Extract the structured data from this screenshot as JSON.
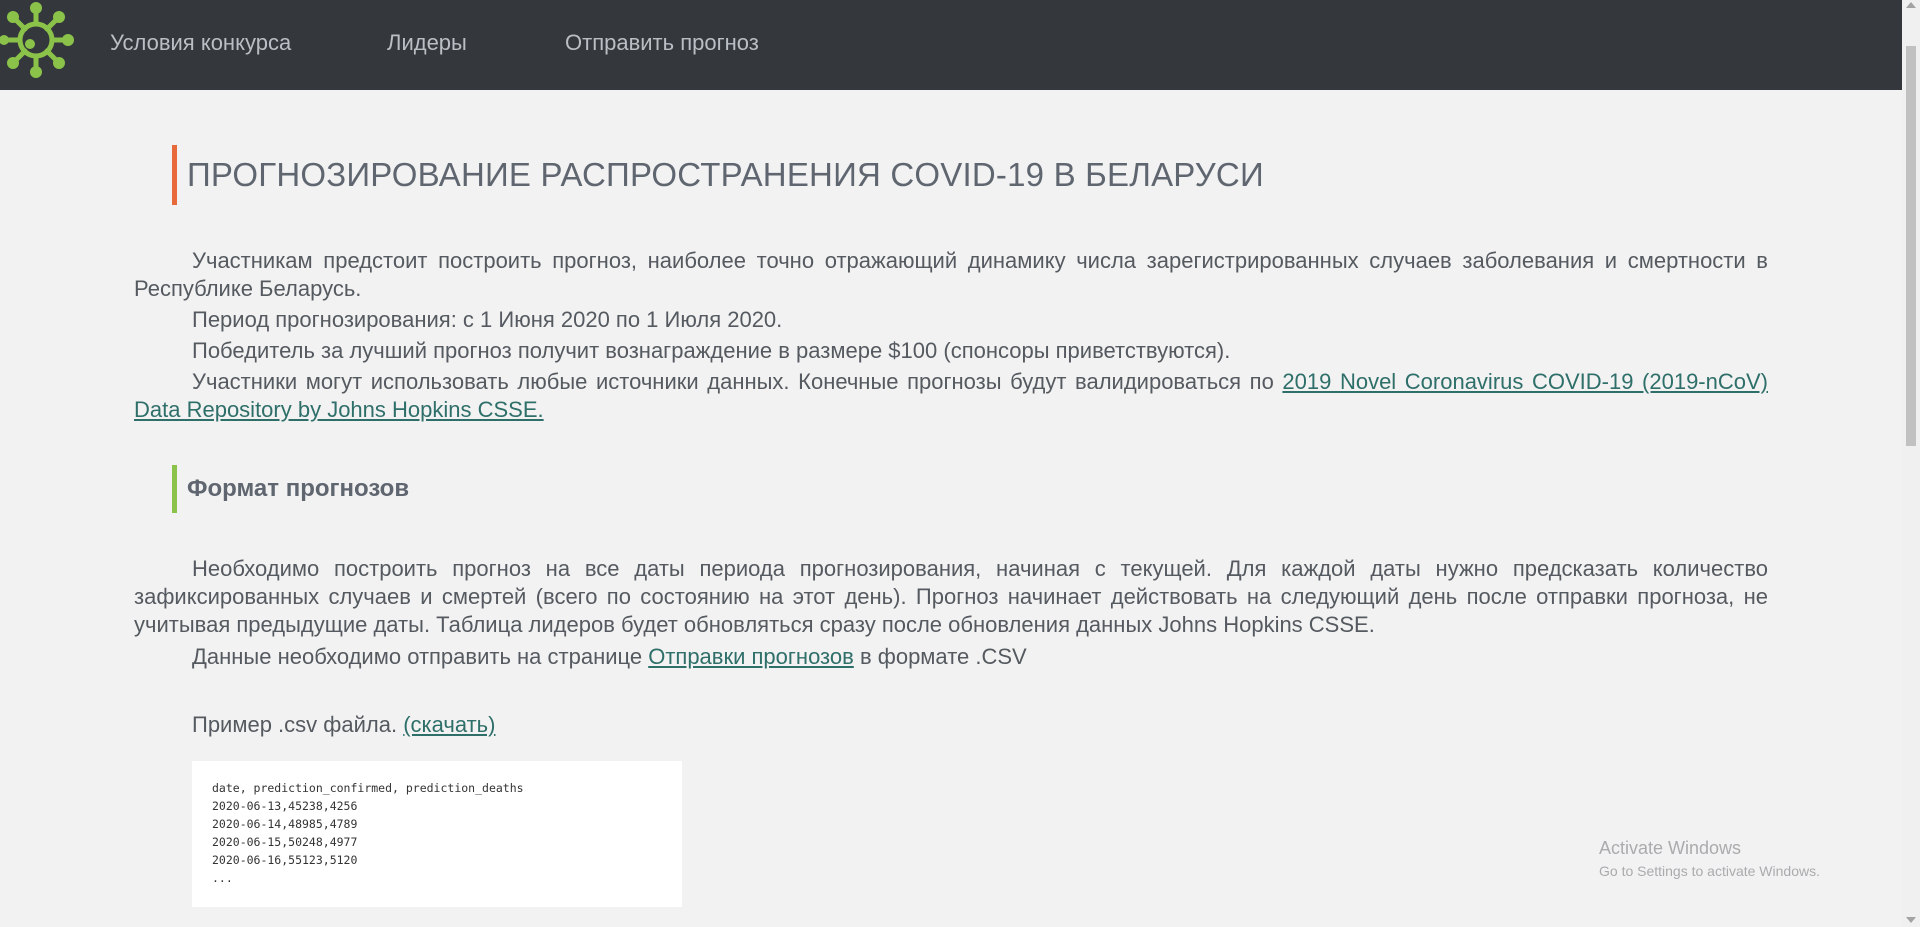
{
  "brand": {
    "logo_icon": "virus-logo-icon",
    "logo_color": "#8bc34a"
  },
  "nav": {
    "items": [
      {
        "label": "Условия конкурса"
      },
      {
        "label": "Лидеры"
      },
      {
        "label": "Отправить прогноз"
      }
    ]
  },
  "main": {
    "title": "ПРОГНОЗИРОВАНИЕ РАСПРОСТРАНЕНИЯ COVID-19 В БЕЛАРУСИ",
    "intro": {
      "p1": "Участникам предстоит построить прогноз, наиболее точно отражающий динамику числа зарегистрированных случаев заболевания и смертности в Республике Беларусь.",
      "p2": "Период прогнозирования: с 1 Июня 2020 по 1 Июля 2020.",
      "p3": "Победитель за лучший прогноз получит вознаграждение в размере $100 (спонсоры приветствуются).",
      "p4_text": "Участники могут использовать любые источники данных. Конечные прогнозы будут валидироваться по ",
      "p4_link": "2019 Novel Coronavirus COVID-19 (2019-nCoV) Data Repository by Johns Hopkins CSSE."
    },
    "format_section": {
      "heading": "Формат прогнозов",
      "p1": "Необходимо построить прогноз на все даты периода прогнозирования, начиная с текущей. Для каждой даты нужно предсказать количество зафиксированных случаев и смертей (всего по состоянию на этот день). Прогноз начинает действовать на следующий день после отправки прогноза, не учитывая предыдущие даты. Таблица лидеров будет обновляться сразу после обновления данных Johns Hopkins CSSE.",
      "p2_before": "Данные необходимо отправить на странице ",
      "p2_link": "Отправки прогнозов",
      "p2_after": " в формате .CSV",
      "example_text": "Пример .csv файла. ",
      "example_link": "(скачать)",
      "code": "date, prediction_confirmed, prediction_deaths\n2020-06-13,45238,4256\n2020-06-14,48985,4789\n2020-06-15,50248,4977\n2020-06-16,55123,5120\n..."
    }
  },
  "watermark": {
    "title": "Activate Windows",
    "subtitle": "Go to Settings to activate Windows."
  },
  "colors": {
    "navbar": "#34373b",
    "accent_title": "#e8693a",
    "accent_section": "#8bc34a",
    "link": "#2f6f6a",
    "background": "#f2f2f2"
  }
}
